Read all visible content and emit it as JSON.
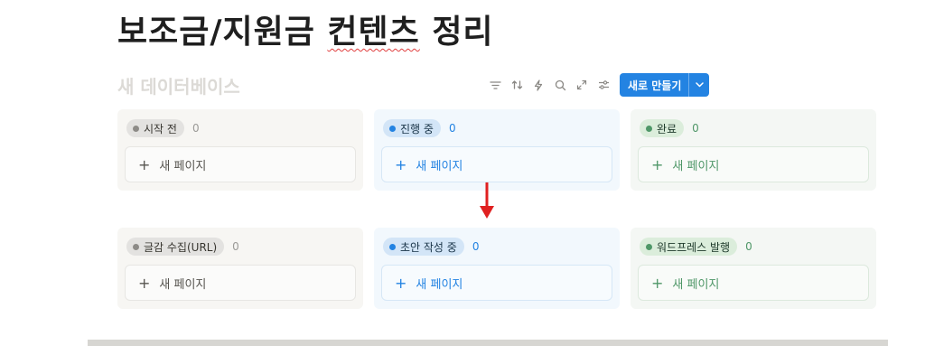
{
  "page": {
    "title_part1": "보조금/지원금 ",
    "title_part2": "컨텐츠",
    "title_part3": " 정리",
    "database_name": "새 데이터베이스"
  },
  "toolbar": {
    "icons": [
      "filter-icon",
      "sort-icon",
      "automation-icon",
      "search-icon",
      "expand-icon",
      "settings-icon"
    ],
    "new_button_label": "새로 만들기",
    "accent_color": "#2383e2"
  },
  "board_top": {
    "columns": [
      {
        "label": "시작 전",
        "count": "0",
        "color": "gray",
        "card_label": "새 페이지"
      },
      {
        "label": "진행 중",
        "count": "0",
        "color": "blue",
        "card_label": "새 페이지"
      },
      {
        "label": "완료",
        "count": "0",
        "color": "green",
        "card_label": "새 페이지"
      }
    ]
  },
  "board_bottom": {
    "columns": [
      {
        "label": "글감 수집(URL)",
        "count": "0",
        "color": "gray",
        "card_label": "새 페이지"
      },
      {
        "label": "초안 작성 중",
        "count": "0",
        "color": "blue",
        "card_label": "새 페이지"
      },
      {
        "label": "워드프레스 발행",
        "count": "0",
        "color": "green",
        "card_label": "새 페이지"
      }
    ]
  },
  "annotation": {
    "arrow_color": "#e02020"
  }
}
